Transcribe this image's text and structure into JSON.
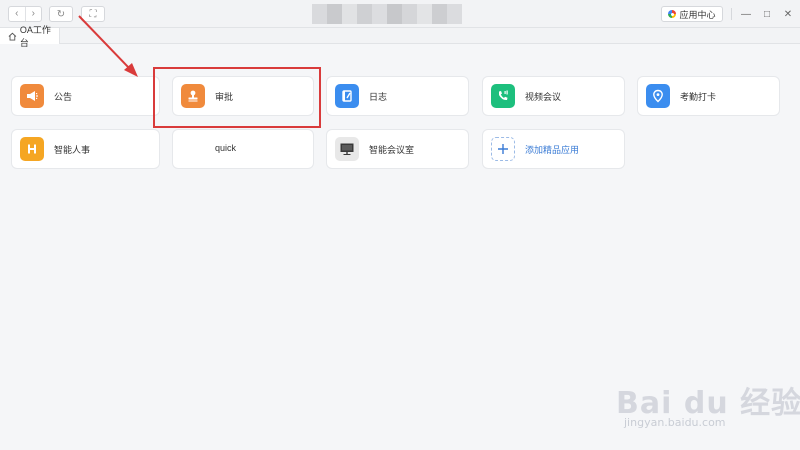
{
  "window": {
    "nav_back": "‹",
    "nav_forward": "›",
    "refresh": "↻",
    "fullscreen": "⛶",
    "app_center_label": "应用中心",
    "minimize": "—",
    "maximize": "□",
    "close": "✕"
  },
  "tabs": [
    {
      "label": "OA工作台"
    }
  ],
  "apps": [
    {
      "label": "公告",
      "icon": "megaphone-icon",
      "color": "#f08a3c"
    },
    {
      "label": "审批",
      "icon": "stamp-icon",
      "color": "#f08a3c"
    },
    {
      "label": "日志",
      "icon": "journal-icon",
      "color": "#3b8def"
    },
    {
      "label": "视频会议",
      "icon": "video-call-icon",
      "color": "#1dbf7d"
    },
    {
      "label": "考勤打卡",
      "icon": "location-pin-icon",
      "color": "#3b8def"
    },
    {
      "label": "智能人事",
      "icon": "hr-icon",
      "color": "#f5a623"
    },
    {
      "label": "quick",
      "icon": "",
      "color": ""
    },
    {
      "label": "智能会议室",
      "icon": "monitor-icon",
      "color": "#e8e8e8"
    },
    {
      "label": "添加精品应用",
      "icon": "plus-icon",
      "color": "#3a7bd5"
    }
  ],
  "watermark": {
    "main": "Bai du 经验",
    "sub": "jingyan.baidu.com"
  }
}
